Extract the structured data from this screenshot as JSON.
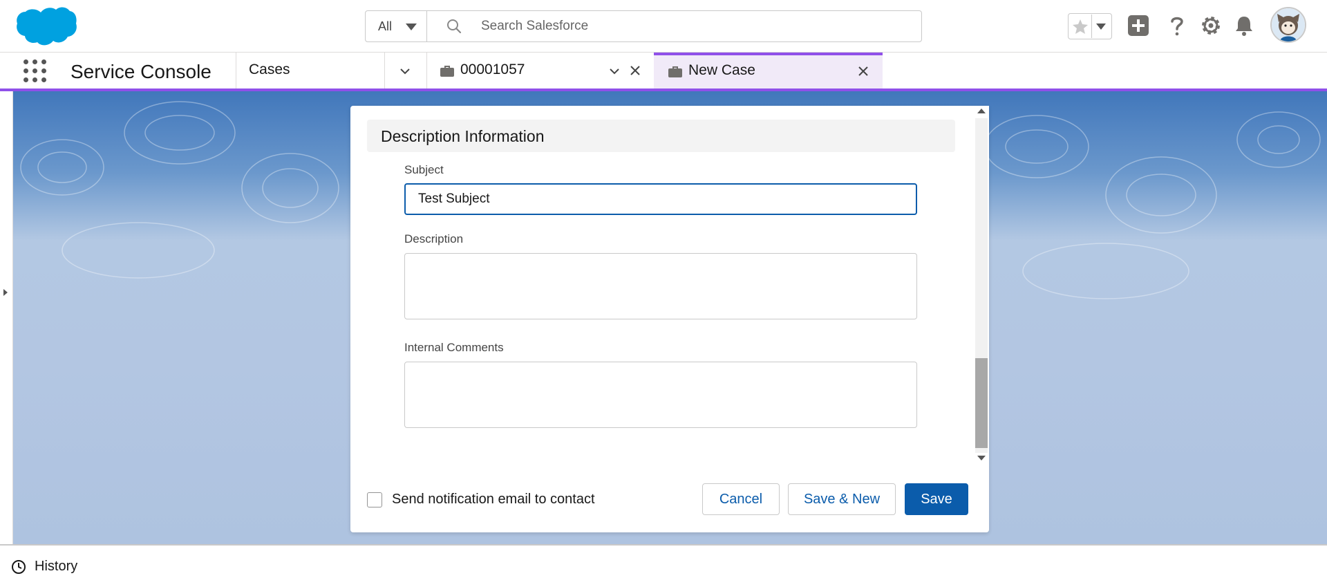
{
  "header": {
    "search_scope": "All",
    "search_placeholder": "Search Salesforce"
  },
  "nav": {
    "app_name": "Service Console",
    "tabs": [
      {
        "label": "Cases"
      },
      {
        "label": "00001057"
      },
      {
        "label": "New Case",
        "active": true
      }
    ]
  },
  "modal": {
    "section_title": "Description Information",
    "subject_label": "Subject",
    "subject_value": "Test Subject",
    "description_label": "Description",
    "description_value": "",
    "internal_comments_label": "Internal Comments",
    "internal_comments_value": "",
    "notify_label": "Send notification email to contact",
    "notify_checked": false,
    "cancel_label": "Cancel",
    "save_new_label": "Save & New",
    "save_label": "Save"
  },
  "utility": {
    "history_label": "History"
  },
  "icons": {
    "logo": "salesforce-cloud-logo",
    "search": "search-icon",
    "favorites": "star-icon",
    "add": "plus-icon",
    "help": "question-icon",
    "setup": "gear-icon",
    "notifications": "bell-icon",
    "avatar": "astro-avatar",
    "app_launcher": "waffle-icon",
    "case": "briefcase-icon",
    "history": "clock-icon"
  },
  "colors": {
    "brand": "#0b5cab",
    "accent": "#9050e9",
    "logo": "#00a1e0"
  }
}
